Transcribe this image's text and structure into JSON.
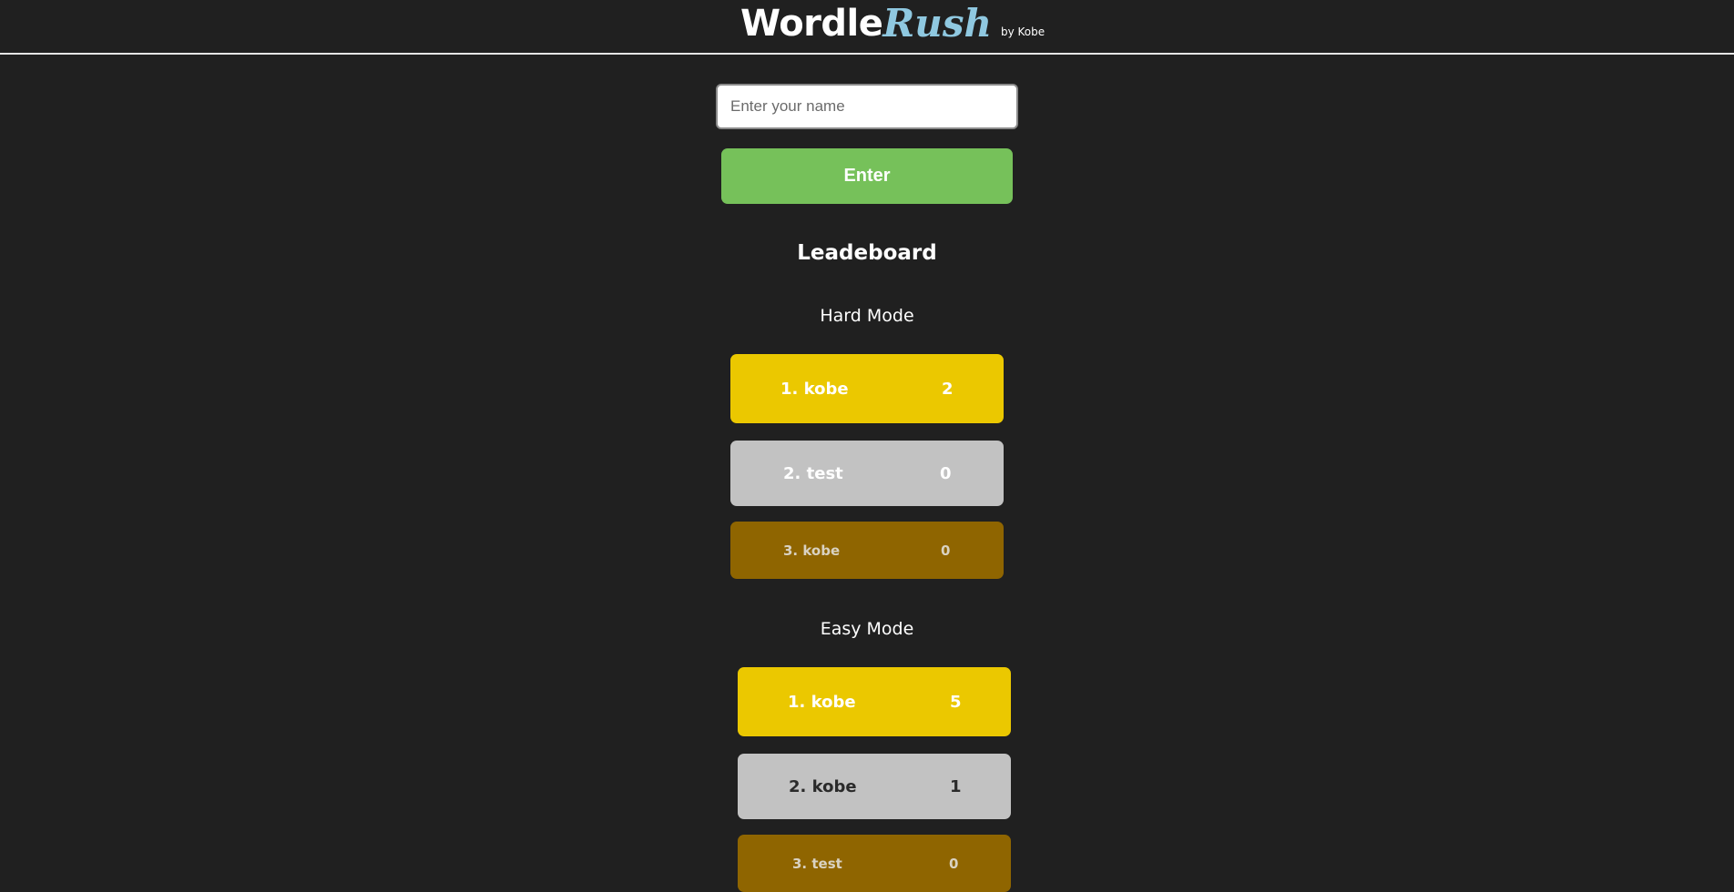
{
  "header": {
    "brand_main": "Wordle",
    "brand_accent": "Rush",
    "brand_by": "by Kobe"
  },
  "form": {
    "name_placeholder": "Enter your name",
    "name_value": "",
    "enter_label": "Enter"
  },
  "leaderboard": {
    "title": "Leadeboard",
    "hard": {
      "title": "Hard Mode",
      "entries": [
        {
          "rank_name": "1. kobe",
          "score": "2"
        },
        {
          "rank_name": "2. test",
          "score": "0"
        },
        {
          "rank_name": "3. kobe",
          "score": "0"
        }
      ]
    },
    "easy": {
      "title": "Easy Mode",
      "entries": [
        {
          "rank_name": "1. kobe",
          "score": "5"
        },
        {
          "rank_name": "2. kobe",
          "score": "1"
        },
        {
          "rank_name": "3. test",
          "score": "0"
        }
      ]
    }
  },
  "colors": {
    "background": "#202020",
    "gold": "#ebc800",
    "silver": "#c2c2c2",
    "bronze": "#8f6500",
    "enter_button": "#76c15a",
    "brand_accent": "#8fc8e0"
  }
}
